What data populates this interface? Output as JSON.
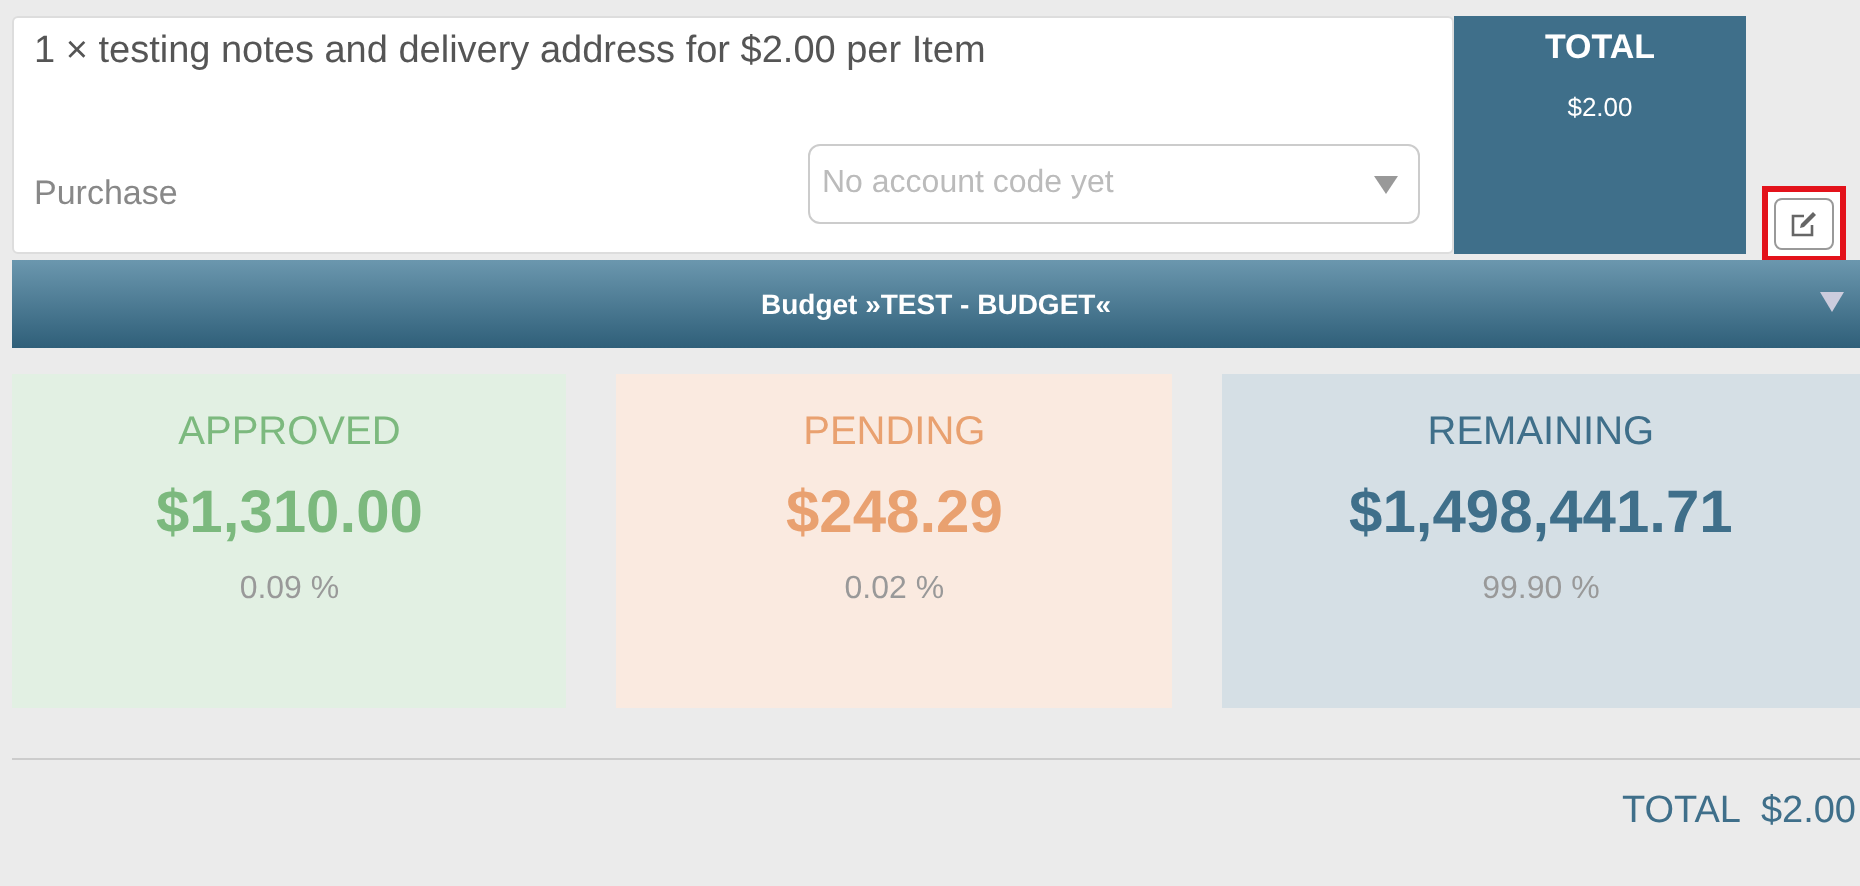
{
  "item": {
    "description": "1 × testing notes and delivery address for $2.00 per Item",
    "type": "Purchase",
    "account_select": {
      "placeholder": "No account code yet"
    },
    "total_label": "TOTAL",
    "total_value": "$2.00"
  },
  "budget_bar": {
    "title": "Budget »TEST - BUDGET«",
    "expanded": false
  },
  "stats": [
    {
      "label": "APPROVED",
      "amount": "$1,310.00",
      "percent": "0.09 %",
      "color": "#7cb97e"
    },
    {
      "label": "PENDING",
      "amount": "$248.29",
      "percent": "0.02 %",
      "color": "#e9a170"
    },
    {
      "label": "REMAINING",
      "amount": "$1,498,441.71",
      "percent": "99.90 %",
      "color": "#3f6f8a"
    }
  ],
  "footer": {
    "label": "TOTAL",
    "value": "$2.00"
  }
}
